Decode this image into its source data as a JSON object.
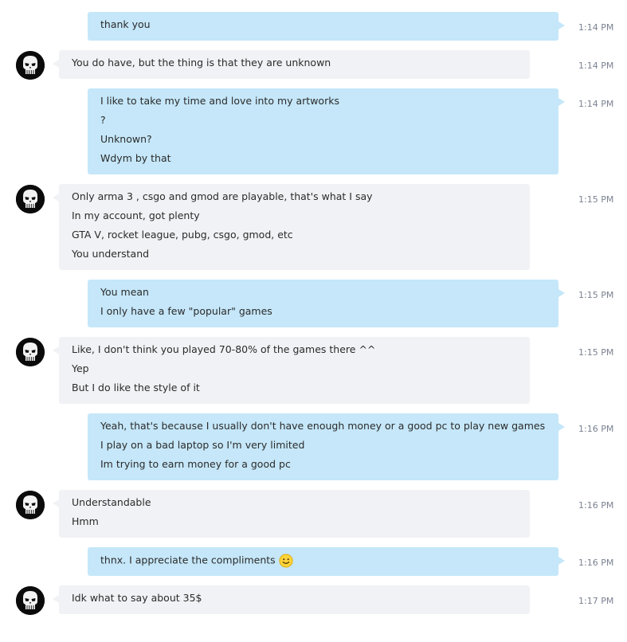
{
  "colors": {
    "outgoing_bubble": "#c5e7f9",
    "incoming_bubble": "#f1f2f5",
    "timestamp": "#7a8290"
  },
  "avatar": {
    "icon": "punisher-skull-icon"
  },
  "messages": [
    {
      "direction": "out",
      "time": "1:14 PM",
      "lines": [
        "thank you"
      ]
    },
    {
      "direction": "in",
      "time": "1:14 PM",
      "lines": [
        "You do have, but the thing is that they are unknown"
      ]
    },
    {
      "direction": "out",
      "time": "1:14 PM",
      "lines": [
        "I like to take my time and love into my artworks",
        "?",
        "Unknown?",
        "Wdym by that"
      ]
    },
    {
      "direction": "in",
      "time": "1:15 PM",
      "lines": [
        "Only arma 3 , csgo and gmod are playable, that's what I say",
        "In my account, got plenty",
        "GTA V, rocket league, pubg, csgo, gmod, etc",
        "You understand"
      ]
    },
    {
      "direction": "out",
      "time": "1:15 PM",
      "lines": [
        "You mean",
        "I only have a few \"popular\" games"
      ]
    },
    {
      "direction": "in",
      "time": "1:15 PM",
      "lines": [
        "Like, I don't think you played 70-80% of the games there ^^",
        "Yep",
        "But I do like the style of it"
      ]
    },
    {
      "direction": "out",
      "time": "1:16 PM",
      "lines": [
        "Yeah, that's because I usually don't have enough money or a good pc to play new games",
        "I play on a bad laptop so I'm very limited",
        "Im trying to earn money for a good pc"
      ]
    },
    {
      "direction": "in",
      "time": "1:16 PM",
      "lines": [
        "Understandable",
        "Hmm"
      ]
    },
    {
      "direction": "out",
      "time": "1:16 PM",
      "lines": [
        "thnx. I appreciate the compliments"
      ],
      "emoji": "smiley-emoji-icon"
    },
    {
      "direction": "in",
      "time": "1:17 PM",
      "lines": [
        "Idk what to say about 35$"
      ]
    }
  ]
}
